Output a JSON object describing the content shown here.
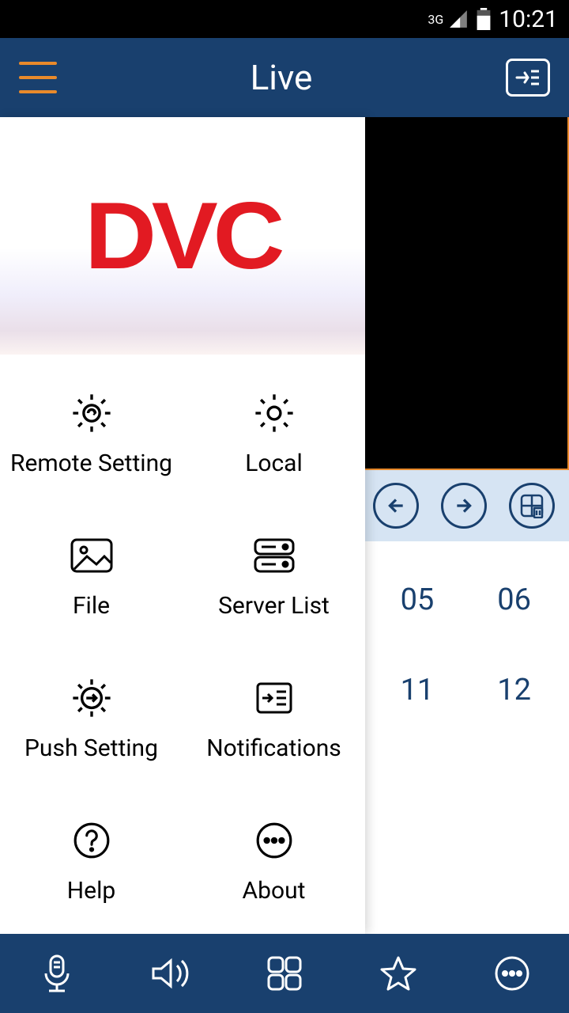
{
  "status": {
    "network": "3G",
    "time": "10:21"
  },
  "header": {
    "title": "Live"
  },
  "logo": "DVC",
  "menu": {
    "remote_setting": "Remote Setting",
    "local": "Local",
    "file": "File",
    "server_list": "Server List",
    "push_setting": "Push Setting",
    "notifications": "Notifications",
    "help": "Help",
    "about": "About"
  },
  "numbers": {
    "a": "05",
    "b": "06",
    "c": "11",
    "d": "12"
  }
}
